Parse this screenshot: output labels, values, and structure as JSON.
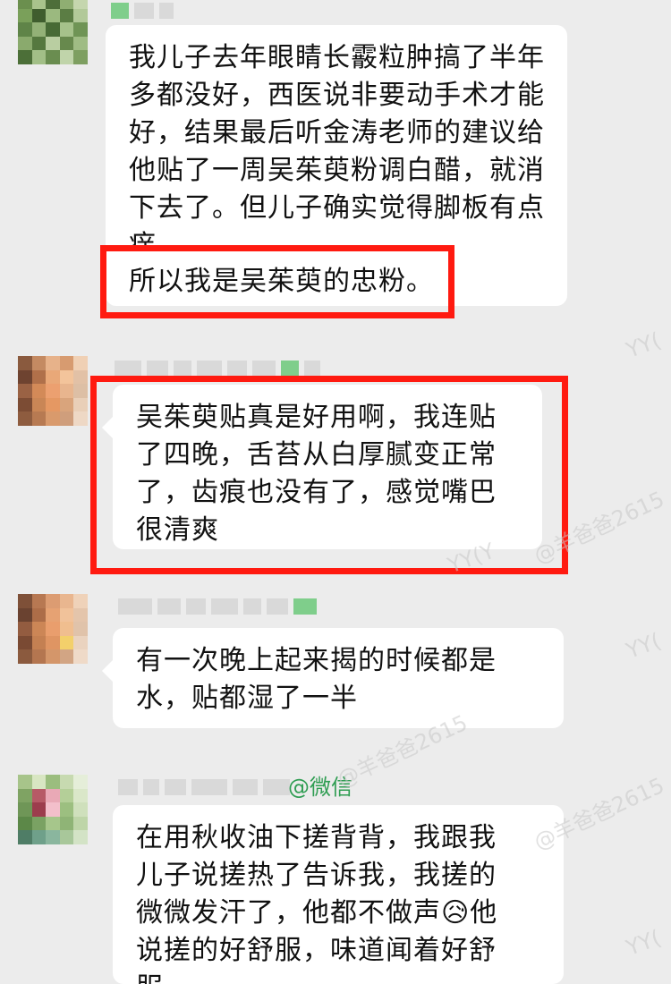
{
  "messages": [
    {
      "id": "m1",
      "lines": [
        "我儿子去年眼睛长霰粒肿搞了半年",
        "多都没好，西医说非要动手术才能",
        "好，结果最后听金涛老师的建议给",
        "他贴了一周吴茱萸粉调白醋，就消",
        "下去了。但儿子确实觉得脚板有点",
        "痒。",
        "所以我是吴茱萸的忠粉。"
      ]
    },
    {
      "id": "m2",
      "lines": [
        "吴茱萸贴真是好用啊，我连贴",
        "了四晚，舌苔从白厚腻变正常",
        "了，齿痕也没有了，感觉嘴巴",
        "很清爽"
      ]
    },
    {
      "id": "m3",
      "lines": [
        "有一次晚上起来揭的时候都是",
        "水，贴都湿了一半"
      ]
    },
    {
      "id": "m4",
      "sender_tag": "@微信",
      "lines": [
        "在用秋收油下搓背背，我跟我",
        "儿子说搓热了告诉我，我搓的",
        "微微发汗了，他都不做声😥他",
        "说搓的好舒服，味道闻着好舒",
        "服"
      ]
    }
  ],
  "watermarks": [
    "YY(",
    "YY(Y",
    "@羊爸爸2615",
    "@羊爸爸2615",
    "YY(",
    "@羊爸爸2615",
    "YY("
  ],
  "colors": {
    "highlight_box": "#ff1a10",
    "background": "#ececec",
    "bubble": "#ffffff",
    "wechat_tag": "#2f9d52"
  }
}
